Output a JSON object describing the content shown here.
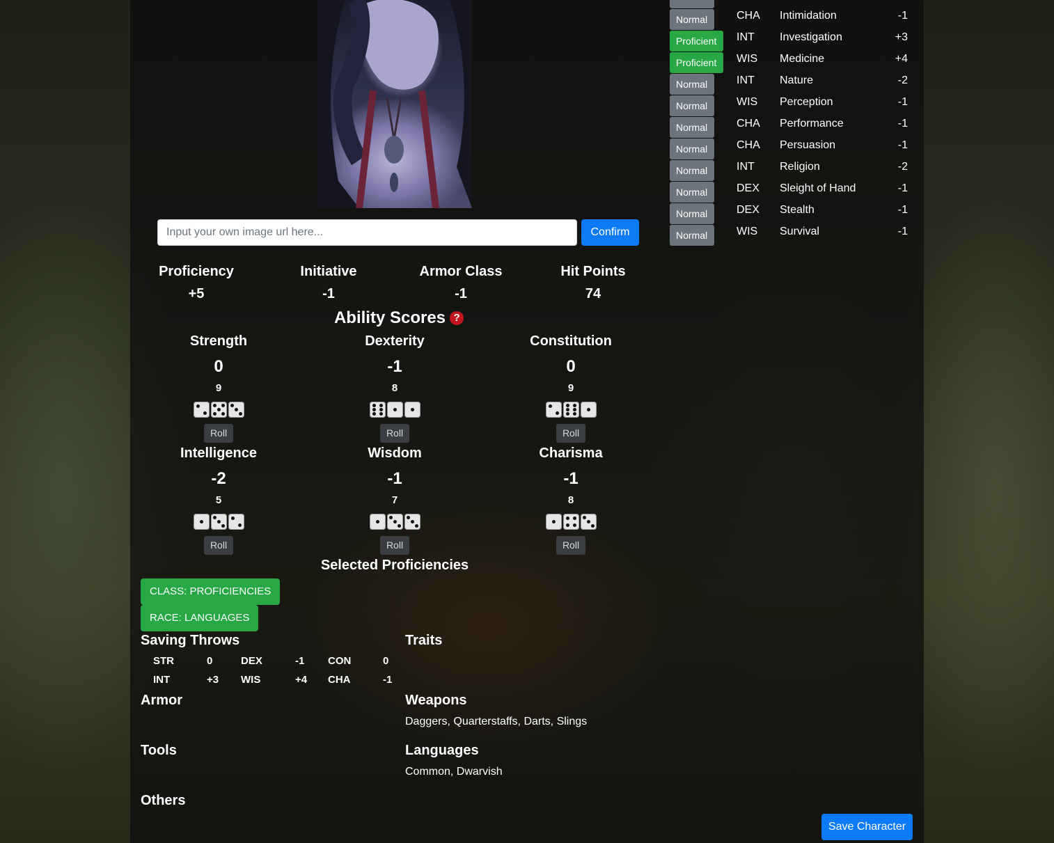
{
  "image_url_input": {
    "placeholder": "Input your own image url here...",
    "value": ""
  },
  "confirm_label": "Confirm",
  "stats": [
    {
      "label": "Proficiency",
      "value": "+5"
    },
    {
      "label": "Initiative",
      "value": "-1"
    },
    {
      "label": "Armor Class",
      "value": "-1"
    },
    {
      "label": "Hit Points",
      "value": "74"
    }
  ],
  "ability_title": "Ability Scores",
  "help_icon": "?",
  "roll_label": "Roll",
  "abilities": [
    {
      "name": "Strength",
      "modifier": "0",
      "score": "9",
      "dice": [
        2,
        5,
        3
      ]
    },
    {
      "name": "Dexterity",
      "modifier": "-1",
      "score": "8",
      "dice": [
        6,
        1,
        1
      ]
    },
    {
      "name": "Constitution",
      "modifier": "0",
      "score": "9",
      "dice": [
        2,
        6,
        1
      ]
    },
    {
      "name": "Intelligence",
      "modifier": "-2",
      "score": "5",
      "dice": [
        1,
        3,
        2
      ]
    },
    {
      "name": "Wisdom",
      "modifier": "-1",
      "score": "7",
      "dice": [
        1,
        3,
        3
      ]
    },
    {
      "name": "Charisma",
      "modifier": "-1",
      "score": "8",
      "dice": [
        1,
        4,
        3
      ]
    }
  ],
  "selected_proficiencies_title": "Selected Proficiencies",
  "tags": [
    "CLASS: PROFICIENCIES",
    "RACE: LANGUAGES"
  ],
  "saving_throws": {
    "title": "Saving Throws",
    "rows": [
      [
        {
          "abil": "STR",
          "val": "0"
        },
        {
          "abil": "DEX",
          "val": "-1"
        },
        {
          "abil": "CON",
          "val": "0"
        }
      ],
      [
        {
          "abil": "INT",
          "val": "+3"
        },
        {
          "abil": "WIS",
          "val": "+4"
        },
        {
          "abil": "CHA",
          "val": "-1"
        }
      ]
    ]
  },
  "traits_title": "Traits",
  "armor_title": "Armor",
  "weapons": {
    "title": "Weapons",
    "text": "Daggers, Quarterstaffs, Darts, Slings"
  },
  "tools_title": "Tools",
  "languages": {
    "title": "Languages",
    "text": "Common, Dwarvish"
  },
  "others_title": "Others",
  "save_label": "Save Character",
  "skills": [
    {
      "prof": "Normal",
      "abil": "CHA",
      "name": "Intimidation",
      "mod": "-1"
    },
    {
      "prof": "Proficient",
      "abil": "INT",
      "name": "Investigation",
      "mod": "+3"
    },
    {
      "prof": "Proficient",
      "abil": "WIS",
      "name": "Medicine",
      "mod": "+4"
    },
    {
      "prof": "Normal",
      "abil": "INT",
      "name": "Nature",
      "mod": "-2"
    },
    {
      "prof": "Normal",
      "abil": "WIS",
      "name": "Perception",
      "mod": "-1"
    },
    {
      "prof": "Normal",
      "abil": "CHA",
      "name": "Performance",
      "mod": "-1"
    },
    {
      "prof": "Normal",
      "abil": "CHA",
      "name": "Persuasion",
      "mod": "-1"
    },
    {
      "prof": "Normal",
      "abil": "INT",
      "name": "Religion",
      "mod": "-2"
    },
    {
      "prof": "Normal",
      "abil": "DEX",
      "name": "Sleight of Hand",
      "mod": "-1"
    },
    {
      "prof": "Normal",
      "abil": "DEX",
      "name": "Stealth",
      "mod": "-1"
    },
    {
      "prof": "Normal",
      "abil": "WIS",
      "name": "Survival",
      "mod": "-1"
    }
  ],
  "colors": {
    "primary": "#0d7bf5",
    "success": "#28a745",
    "secondary": "#6c757d",
    "danger": "#c0161e"
  }
}
